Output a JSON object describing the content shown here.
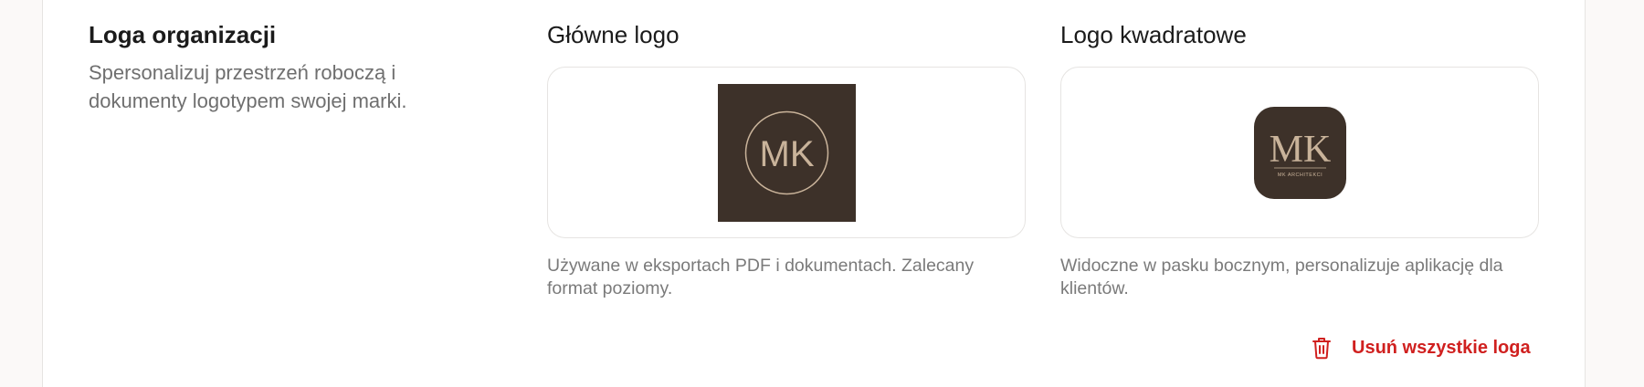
{
  "section": {
    "title": "Loga organizacji",
    "description": "Spersonalizuj przestrzeń roboczą i dokumenty logotypem swojej marki."
  },
  "main_logo": {
    "title": "Główne logo",
    "image_text": "MK",
    "hint": "Używane w eksportach PDF i dokumentach. Zalecany format poziomy."
  },
  "square_logo": {
    "title": "Logo kwadratowe",
    "image_text": "MK",
    "image_subtext": "MK ARCHITEKCI",
    "hint": "Widoczne w pasku bocznym, personalizuje aplikację dla klientów."
  },
  "actions": {
    "remove_all_label": "Usuń wszystkie loga",
    "remove_icon": "trash-icon"
  },
  "colors": {
    "logo_background": "#3d3129",
    "logo_accent": "#c9b39a",
    "danger": "#d0201f"
  }
}
